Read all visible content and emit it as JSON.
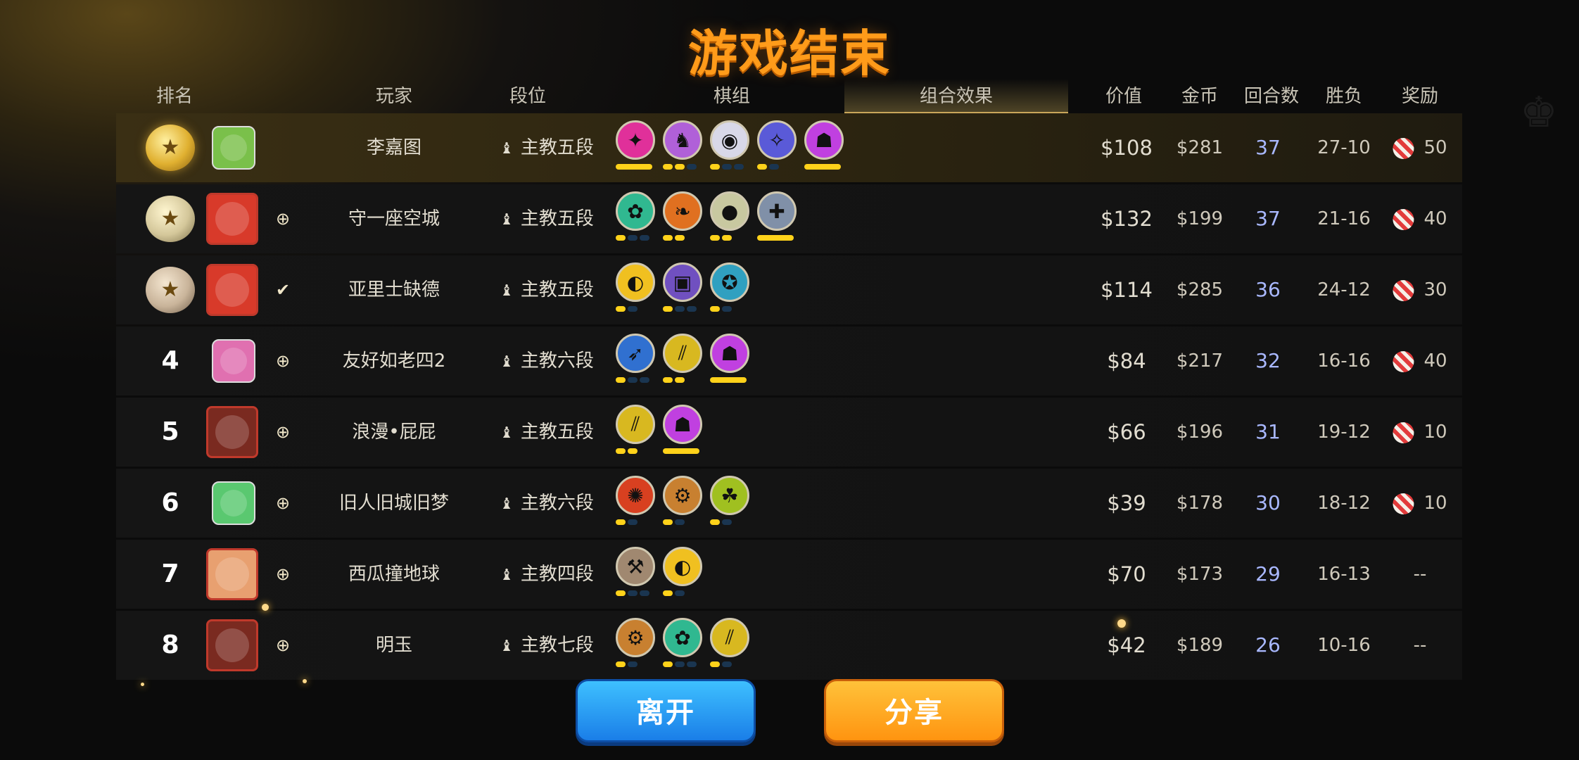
{
  "title": "游戏结束",
  "columns": {
    "rank": "排名",
    "player": "玩家",
    "tier": "段位",
    "pieces": "棋组",
    "synergy": "组合效果",
    "value": "价值",
    "gold": "金币",
    "rounds": "回合数",
    "winloss": "胜负",
    "reward": "奖励"
  },
  "active_tab": "组合效果",
  "players": [
    {
      "rank": "1",
      "name": "李嘉图",
      "tier": "主教五段",
      "value": "$108",
      "gold": "$281",
      "rounds": "37",
      "winloss": "27-10",
      "reward": "50",
      "traits": [
        {
          "icon": "dragon-icon",
          "color": "#e0309a",
          "pips": [
            1
          ]
        },
        {
          "icon": "knight-icon",
          "color": "#b060d8",
          "pips": [
            1,
            1,
            0
          ]
        },
        {
          "icon": "helmet-icon",
          "color": "#d8d8e8",
          "pips": [
            1,
            0,
            0
          ]
        },
        {
          "icon": "fish-icon",
          "color": "#5a5ad8",
          "pips": [
            1,
            0
          ]
        },
        {
          "icon": "demon-icon",
          "color": "#c040e0",
          "pips": [
            1
          ]
        }
      ]
    },
    {
      "rank": "2",
      "name": "守一座空城",
      "tier": "主教五段",
      "value": "$132",
      "gold": "$199",
      "rounds": "37",
      "winloss": "21-16",
      "reward": "40",
      "traits": [
        {
          "icon": "paw-icon",
          "color": "#30b890",
          "pips": [
            1,
            0,
            0
          ]
        },
        {
          "icon": "leaf-icon",
          "color": "#e07020",
          "pips": [
            1,
            1
          ]
        },
        {
          "icon": "penguin-icon",
          "color": "#c8c8a0",
          "pips": [
            1,
            1
          ]
        },
        {
          "icon": "cross-icon",
          "color": "#8090a8",
          "pips": [
            1
          ]
        }
      ]
    },
    {
      "rank": "3",
      "name": "亚里士缺德",
      "tier": "主教五段",
      "value": "$114",
      "gold": "$285",
      "rounds": "36",
      "winloss": "24-12",
      "reward": "30",
      "traits": [
        {
          "icon": "spirit-icon",
          "color": "#f0c020",
          "pips": [
            1,
            0
          ]
        },
        {
          "icon": "mask-icon",
          "color": "#7050c0",
          "pips": [
            1,
            0,
            0
          ]
        },
        {
          "icon": "rune-icon",
          "color": "#30a0c0",
          "pips": [
            1,
            0
          ]
        }
      ]
    },
    {
      "rank": "4",
      "name": "友好如老四2",
      "tier": "主教六段",
      "value": "$84",
      "gold": "$217",
      "rounds": "32",
      "winloss": "16-16",
      "reward": "40",
      "traits": [
        {
          "icon": "feather-icon",
          "color": "#3070d0",
          "pips": [
            1,
            0,
            0
          ]
        },
        {
          "icon": "claw-icon",
          "color": "#d8b820",
          "pips": [
            1,
            1
          ]
        },
        {
          "icon": "demon-icon",
          "color": "#c040e0",
          "pips": [
            1
          ]
        }
      ]
    },
    {
      "rank": "5",
      "name": "浪漫•屁屁",
      "tier": "主教五段",
      "value": "$66",
      "gold": "$196",
      "rounds": "31",
      "winloss": "19-12",
      "reward": "10",
      "traits": [
        {
          "icon": "claw-icon",
          "color": "#d8b820",
          "pips": [
            1,
            1
          ]
        },
        {
          "icon": "demon-icon",
          "color": "#c040e0",
          "pips": [
            1
          ]
        }
      ]
    },
    {
      "rank": "6",
      "name": "旧人旧城旧梦",
      "tier": "主教六段",
      "value": "$39",
      "gold": "$178",
      "rounds": "30",
      "winloss": "18-12",
      "reward": "10",
      "traits": [
        {
          "icon": "beast-icon",
          "color": "#d84020",
          "pips": [
            1,
            0
          ]
        },
        {
          "icon": "gear-icon",
          "color": "#c88030",
          "pips": [
            1,
            0
          ]
        },
        {
          "icon": "goblin-icon",
          "color": "#a0c020",
          "pips": [
            1,
            0
          ]
        }
      ]
    },
    {
      "rank": "7",
      "name": "西瓜撞地球",
      "tier": "主教四段",
      "value": "$70",
      "gold": "$173",
      "rounds": "29",
      "winloss": "16-13",
      "reward": "--",
      "traits": [
        {
          "icon": "axe-icon",
          "color": "#a08870",
          "pips": [
            1,
            0,
            0
          ]
        },
        {
          "icon": "spirit-icon",
          "color": "#f0c020",
          "pips": [
            1,
            0
          ]
        }
      ]
    },
    {
      "rank": "8",
      "name": "明玉",
      "tier": "主教七段",
      "value": "$42",
      "gold": "$189",
      "rounds": "26",
      "winloss": "10-16",
      "reward": "--",
      "traits": [
        {
          "icon": "gear-icon",
          "color": "#c88030",
          "pips": [
            1,
            0
          ]
        },
        {
          "icon": "paw-icon",
          "color": "#30b890",
          "pips": [
            1,
            0,
            0
          ]
        },
        {
          "icon": "claw-icon",
          "color": "#d8b820",
          "pips": [
            1,
            0
          ]
        }
      ]
    }
  ],
  "buttons": {
    "leave": "离开",
    "share": "分享"
  }
}
